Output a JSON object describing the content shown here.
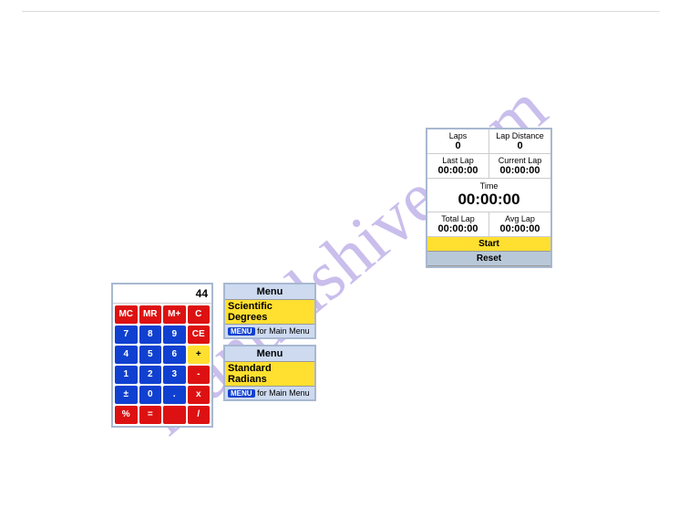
{
  "watermark": "manualshive.com",
  "calc": {
    "display": "44",
    "keys": [
      {
        "t": "MC",
        "c": "r"
      },
      {
        "t": "MR",
        "c": "r"
      },
      {
        "t": "M+",
        "c": "r"
      },
      {
        "t": "C",
        "c": "r"
      },
      {
        "t": "7",
        "c": "b"
      },
      {
        "t": "8",
        "c": "b"
      },
      {
        "t": "9",
        "c": "b"
      },
      {
        "t": "CE",
        "c": "r"
      },
      {
        "t": "4",
        "c": "b"
      },
      {
        "t": "5",
        "c": "b"
      },
      {
        "t": "6",
        "c": "b"
      },
      {
        "t": "+",
        "c": "y"
      },
      {
        "t": "1",
        "c": "b"
      },
      {
        "t": "2",
        "c": "b"
      },
      {
        "t": "3",
        "c": "b"
      },
      {
        "t": "-",
        "c": "r"
      },
      {
        "t": "±",
        "c": "b"
      },
      {
        "t": "0",
        "c": "b"
      },
      {
        "t": ".",
        "c": "b"
      },
      {
        "t": "x",
        "c": "r"
      },
      {
        "t": "%",
        "c": "r"
      },
      {
        "t": "=",
        "c": "r"
      },
      {
        "t": "",
        "c": "r"
      },
      {
        "t": "/",
        "c": "r"
      }
    ]
  },
  "menu1": {
    "head": "Menu",
    "l1": "Scientific",
    "l2": "Degrees",
    "btn": "MENU",
    "foot": "for Main Menu"
  },
  "menu2": {
    "head": "Menu",
    "l1": "Standard",
    "l2": "Radians",
    "btn": "MENU",
    "foot": "for Main Menu"
  },
  "sw": {
    "laps_l": "Laps",
    "laps_v": "0",
    "dist_l": "Lap Distance",
    "dist_v": "0",
    "last_l": "Last Lap",
    "last_v": "00:00:00",
    "cur_l": "Current Lap",
    "cur_v": "00:00:00",
    "time_l": "Time",
    "time_v": "00:00:00",
    "tot_l": "Total Lap",
    "tot_v": "00:00:00",
    "avg_l": "Avg Lap",
    "avg_v": "00:00:00",
    "start": "Start",
    "reset": "Reset"
  }
}
